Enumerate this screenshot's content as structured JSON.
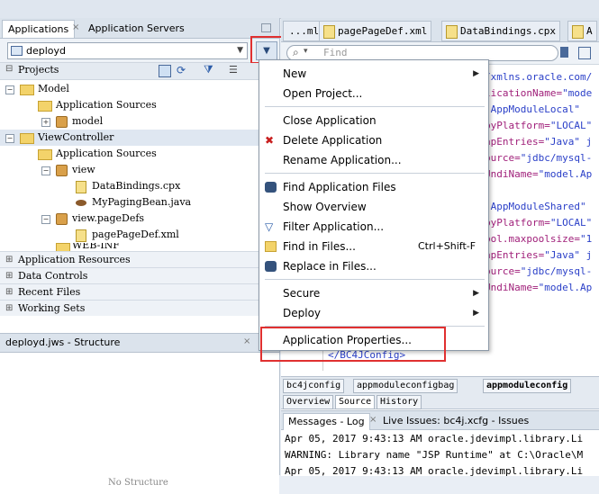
{
  "left_tabs": {
    "applications": "Applications",
    "app_servers": "Application Servers"
  },
  "app_selector": {
    "value": "deployd"
  },
  "projects_label": "Projects",
  "tree": [
    {
      "label": "Model"
    },
    {
      "label": "Application Sources"
    },
    {
      "label": "model"
    },
    {
      "label": "ViewController"
    },
    {
      "label": "Application Sources"
    },
    {
      "label": "view"
    },
    {
      "label": "DataBindings.cpx"
    },
    {
      "label": "MyPagingBean.java"
    },
    {
      "label": "view.pageDefs"
    },
    {
      "label": "pagePageDef.xml"
    },
    {
      "label": "WEB-INF"
    }
  ],
  "accordions": [
    "Application Resources",
    "Data Controls",
    "Recent Files",
    "Working Sets"
  ],
  "structure": {
    "title": "deployd.jws - Structure",
    "empty_text": "No Structure"
  },
  "editor_tabs": [
    "...ml",
    "pagePageDef.xml",
    "DataBindings.cpx",
    "A"
  ],
  "find": {
    "placeholder": "Find"
  },
  "code_lines": [
    {
      "attr": "",
      "val": "/xmlns.oracle.com/"
    },
    {
      "attr": "licationName=",
      "val": "\"mode"
    },
    {
      "attr": "",
      "val": "\"AppModuleLocal\""
    },
    {
      "attr": "byPlatform=",
      "val": "\"LOCAL\""
    },
    {
      "attr": "apEntries=",
      "val": "\"Java\" j"
    },
    {
      "attr": "ource=",
      "val": "\"jdbc/mysql-"
    },
    {
      "attr": "UndiName=",
      "val": "\"model.Ap"
    },
    {
      "attr": "",
      "val": ""
    },
    {
      "attr": "",
      "val": "\"AppModuleShared\""
    },
    {
      "attr": "byPlatform=",
      "val": "\"LOCAL\""
    },
    {
      "attr": "pol.maxpoolsize=",
      "val": "\"1"
    },
    {
      "attr": "apEntries=",
      "val": "\"Java\" j"
    },
    {
      "attr": "ource=",
      "val": "\"jdbc/mysql-"
    },
    {
      "attr": "UndiName=",
      "val": "\"model.Ap"
    }
  ],
  "closing_tag": "</BC4JConfig>",
  "breadcrumbs": [
    "bc4jconfig",
    "appmoduleconfigbag",
    "appmoduleconfig"
  ],
  "view_tabs": [
    "Overview",
    "Source",
    "History"
  ],
  "log_tabs": [
    "Messages - Log",
    "Live Issues: bc4j.xcfg - Issues"
  ],
  "log_lines": [
    "Apr 05, 2017 9:43:13 AM oracle.jdevimpl.library.Li",
    "WARNING: Library name \"JSP Runtime\" at C:\\Oracle\\M",
    "Apr 05, 2017 9:43:13 AM oracle.jdevimpl.library.Li"
  ],
  "menu": {
    "new": "New",
    "open_project": "Open Project...",
    "close_application": "Close Application",
    "delete_application": "Delete Application",
    "rename_application": "Rename Application...",
    "find_application_files": "Find Application Files",
    "show_overview": "Show Overview",
    "filter_application": "Filter Application...",
    "find_in_files": "Find in Files...",
    "find_in_files_shortcut": "Ctrl+Shift-F",
    "replace_in_files": "Replace in Files...",
    "secure": "Secure",
    "deploy": "Deploy",
    "application_properties": "Application Properties..."
  },
  "colors": {
    "highlight_box": "#e03030",
    "attr": "#a0207a",
    "value": "#2a3fc8"
  }
}
